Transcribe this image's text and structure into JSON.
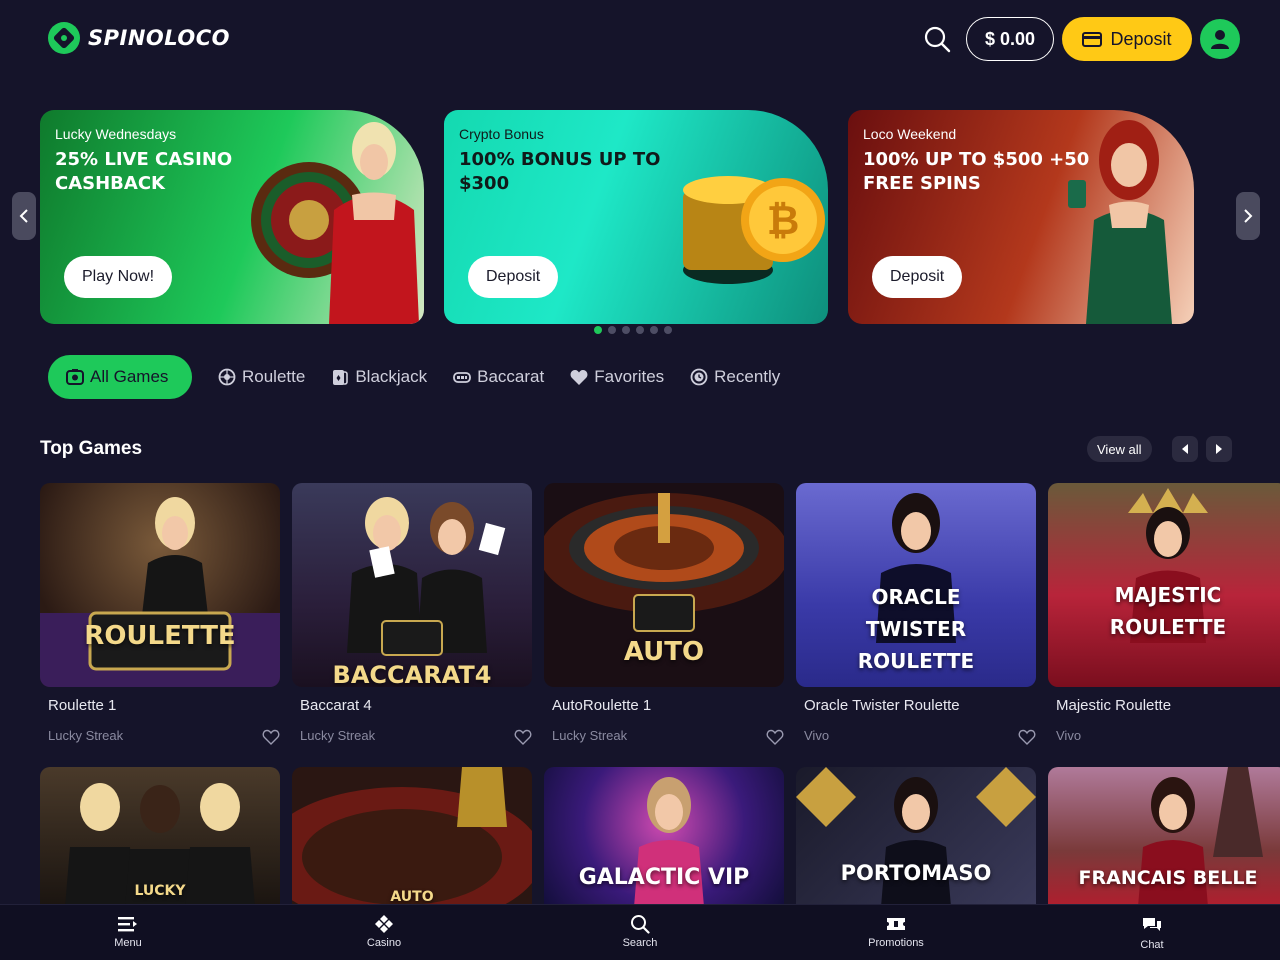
{
  "header": {
    "logo_text": "SPINOLOCO",
    "balance": "$ 0.00",
    "deposit_label": "Deposit"
  },
  "banners": [
    {
      "kicker": "Lucky Wednesdays",
      "title": "25% LIVE CASINO CASHBACK",
      "cta": "Play Now!"
    },
    {
      "kicker": "Crypto Bonus",
      "title": "100% BONUS UP TO $300",
      "cta": "Deposit"
    },
    {
      "kicker": "Loco Weekend",
      "title": "100% UP TO $500 +50 FREE SPINS",
      "cta": "Deposit"
    }
  ],
  "tabs": [
    {
      "label": "All Games",
      "icon": "casino-chip-icon"
    },
    {
      "label": "Roulette",
      "icon": "roulette-icon"
    },
    {
      "label": "Blackjack",
      "icon": "cards-icon"
    },
    {
      "label": "Baccarat",
      "icon": "baccarat-icon"
    },
    {
      "label": "Favorites",
      "icon": "heart-icon"
    },
    {
      "label": "Recently",
      "icon": "clock-icon"
    }
  ],
  "top_games": {
    "title": "Top Games",
    "view_all": "View all",
    "games": [
      {
        "name": "Roulette 1",
        "provider": "Lucky Streak",
        "art_text": "ROULETTE"
      },
      {
        "name": "Baccarat 4",
        "provider": "Lucky Streak",
        "art_text": "BACCARAT4"
      },
      {
        "name": "AutoRoulette 1",
        "provider": "Lucky Streak",
        "art_text": "AUTO"
      },
      {
        "name": "Oracle Twister Roulette",
        "provider": "Vivo",
        "art_text": "ORACLE TWISTER ROULETTE"
      },
      {
        "name": "Majestic Roulette",
        "provider": "Vivo",
        "art_text": "MAJESTIC ROULETTE"
      }
    ],
    "row2_art": [
      "LUCKY",
      "AUTO",
      "GALACTIC VIP",
      "PORTOMASO",
      "FRANCAIS BELLE"
    ]
  },
  "bottom_nav": [
    {
      "label": "Menu",
      "icon": "menu-icon"
    },
    {
      "label": "Casino",
      "icon": "casino-icon"
    },
    {
      "label": "Search",
      "icon": "search-icon"
    },
    {
      "label": "Promotions",
      "icon": "ticket-icon"
    },
    {
      "label": "Chat",
      "icon": "chat-icon"
    }
  ],
  "colors": {
    "background": "#15142a",
    "accent_green": "#1ec95a",
    "deposit_yellow": "#ffc915"
  }
}
